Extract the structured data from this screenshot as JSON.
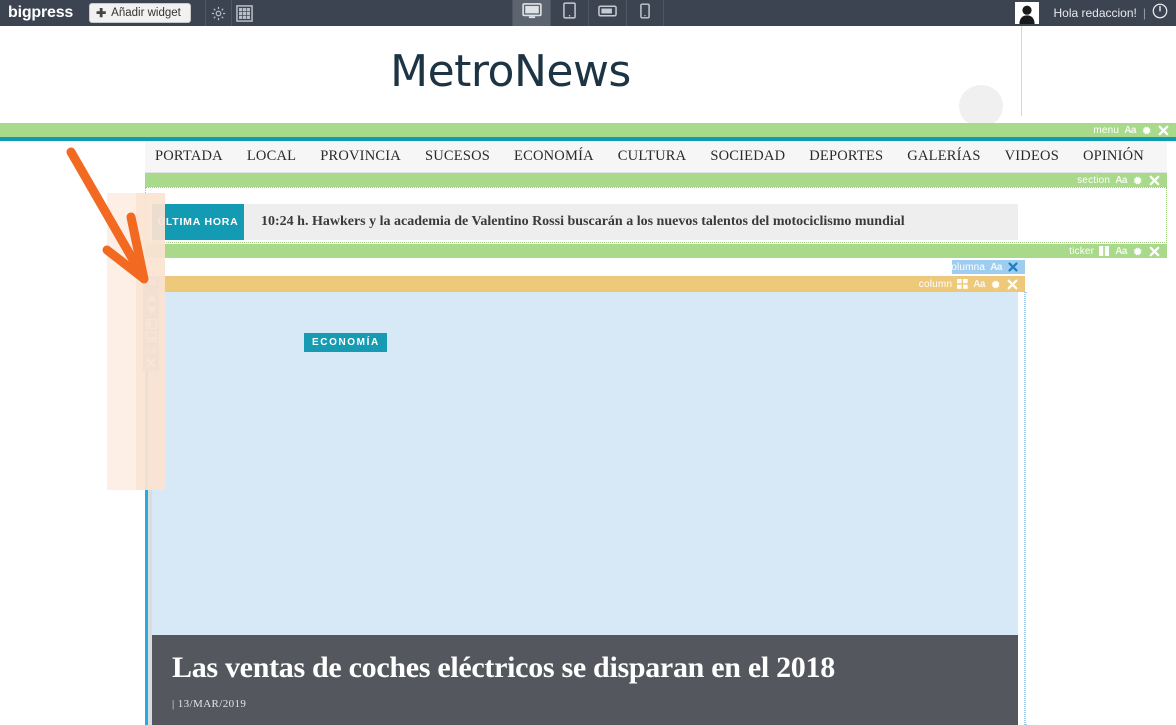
{
  "adminbar": {
    "brand": "bigpress",
    "add_widget_label": "Añadir widget",
    "plus_glyph": "✚",
    "settings_icon": "gear-icon",
    "grid_icon": "grid-icon",
    "greeting": "Hola redaccion!",
    "separator": "|",
    "logout_icon": "power-icon",
    "avatar_icon": "user-avatar-icon",
    "devices": [
      {
        "name": "desktop",
        "label": "Escritorio",
        "active": true
      },
      {
        "name": "tablet-portrait",
        "label": "Tablet vertical",
        "active": false
      },
      {
        "name": "tablet-landscape",
        "label": "Tablet horizontal",
        "active": false
      },
      {
        "name": "mobile",
        "label": "Móvil",
        "active": false
      }
    ]
  },
  "site": {
    "title": "MetroNews",
    "title_color": "#1d3444"
  },
  "nav": {
    "items": [
      "PORTADA",
      "LOCAL",
      "PROVINCIA",
      "SUCESOS",
      "ECONOMÍA",
      "CULTURA",
      "SOCIEDAD",
      "DEPORTES",
      "GALERÍAS",
      "VIDEOS",
      "OPINIÓN"
    ]
  },
  "widget_bars": {
    "menu": {
      "label": "menu",
      "font_icon": "Aa",
      "gear": "gear-icon",
      "close": "✖",
      "color": "#a9d98a"
    },
    "section": {
      "label": "section",
      "font_icon": "Aa",
      "gear": "gear-icon",
      "close": "✖",
      "color": "#a9d98a"
    },
    "ticker": {
      "label": "ticker",
      "cols_icon": "columns-icon",
      "font_icon": "Aa",
      "gear": "gear-icon",
      "close": "✖",
      "color": "#a9d98a"
    },
    "columna": {
      "label": "columna",
      "font_icon": "Aa",
      "close": "✖",
      "color": "#9fcdf0"
    },
    "column": {
      "label": "column",
      "grid_icon": "grid-icon",
      "font_icon": "Aa",
      "gear": "gear-icon",
      "close": "✖",
      "color": "#eec97a"
    }
  },
  "fila_toolbar": {
    "label": "fila",
    "buttons": [
      {
        "name": "move-up-button",
        "glyph": "▲"
      },
      {
        "name": "move-down-button",
        "glyph": "▼"
      },
      {
        "name": "split-vertical-button",
        "glyph": "split-vertical-icon"
      },
      {
        "name": "split-horizontal-button",
        "glyph": "split-horizontal-icon"
      },
      {
        "name": "font-size-button",
        "glyph": "Aa"
      },
      {
        "name": "delete-row-button",
        "glyph": "✖"
      }
    ]
  },
  "ticker": {
    "badge": "ÚLTIMA HORA",
    "time": "10:24 h.",
    "text": "Hawkers y la academia de Valentino Rossi buscarán a los nuevos talentos del motociclismo mundial",
    "badge_color": "#149bb4"
  },
  "article": {
    "category": "ECONOMÍA",
    "category_color": "#169bb2",
    "headline": "Las ventas de coches eléctricos se disparan en el 2018",
    "date": "| 13/MAR/2019",
    "box_color": "#54585e"
  },
  "annotation": {
    "arrow_color": "#f26a21",
    "highlight_color": "#fdece0",
    "type": "arrow-pointing-to-fila-toolbar"
  }
}
